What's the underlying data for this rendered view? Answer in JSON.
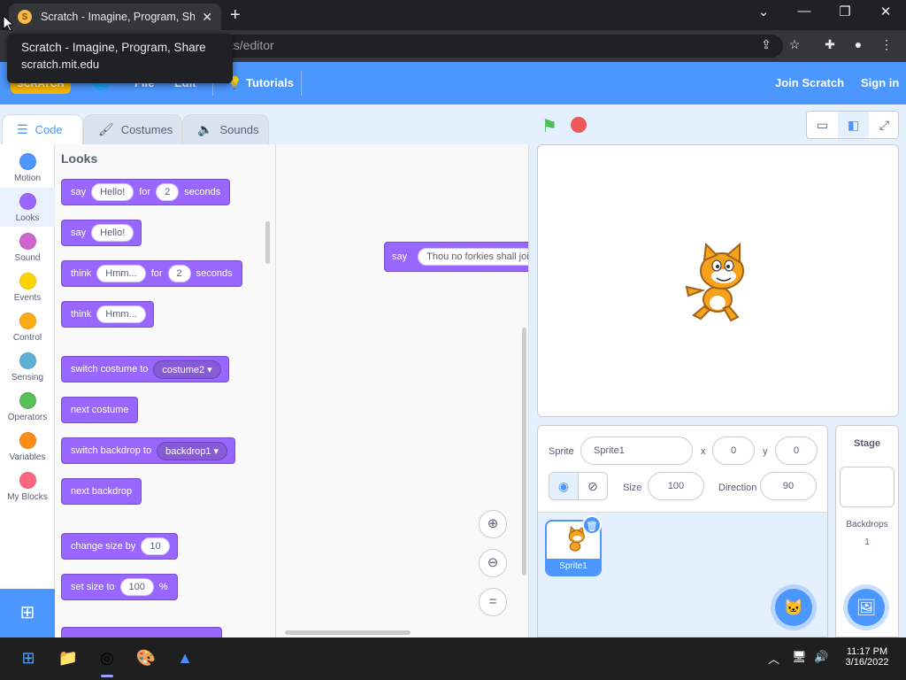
{
  "browser": {
    "tab_title": "Scratch - Imagine, Program, Shar",
    "url": "jects/editor",
    "tooltip_title": "Scratch - Imagine, Program, Share",
    "tooltip_domain": "scratch.mit.edu"
  },
  "menubar": {
    "file": "File",
    "edit": "Edit",
    "tutorials": "Tutorials",
    "join": "Join Scratch",
    "signin": "Sign in"
  },
  "tabs": {
    "code": "Code",
    "costumes": "Costumes",
    "sounds": "Sounds"
  },
  "categories": [
    {
      "label": "Motion",
      "color": "#4c97ff"
    },
    {
      "label": "Looks",
      "color": "#9966ff"
    },
    {
      "label": "Sound",
      "color": "#cf63cf"
    },
    {
      "label": "Events",
      "color": "#ffd500"
    },
    {
      "label": "Control",
      "color": "#ffab19"
    },
    {
      "label": "Sensing",
      "color": "#5cb1d6"
    },
    {
      "label": "Operators",
      "color": "#59c059"
    },
    {
      "label": "Variables",
      "color": "#ff8c1a"
    },
    {
      "label": "My Blocks",
      "color": "#ff6680"
    }
  ],
  "palette": {
    "title": "Looks",
    "say_for": {
      "w1": "say",
      "v1": "Hello!",
      "w2": "for",
      "v2": "2",
      "w3": "seconds"
    },
    "say": {
      "w1": "say",
      "v1": "Hello!"
    },
    "think_for": {
      "w1": "think",
      "v1": "Hmm...",
      "w2": "for",
      "v2": "2",
      "w3": "seconds"
    },
    "think": {
      "w1": "think",
      "v1": "Hmm..."
    },
    "switch_costume": {
      "w1": "switch costume to",
      "v1": "costume2"
    },
    "next_costume": "next costume",
    "switch_backdrop": {
      "w1": "switch backdrop to",
      "v1": "backdrop1"
    },
    "next_backdrop": "next backdrop",
    "change_size": {
      "w1": "change size by",
      "v1": "10"
    },
    "set_size": {
      "w1": "set size to",
      "v1": "100",
      "w2": "%"
    }
  },
  "script": {
    "say_word": "say",
    "say_value": "Thou no forkies shall join."
  },
  "sprite_info": {
    "sprite_label": "Sprite",
    "sprite_name": "Sprite1",
    "x_label": "x",
    "x_value": "0",
    "y_label": "y",
    "y_value": "0",
    "size_label": "Size",
    "size_value": "100",
    "direction_label": "Direction",
    "direction_value": "90"
  },
  "sprite_list": {
    "sprite1": "Sprite1"
  },
  "stage_pane": {
    "title": "Stage",
    "backdrops_label": "Backdrops",
    "backdrops_count": "1"
  },
  "taskbar": {
    "time": "11:17 PM",
    "date": "3/16/2022"
  }
}
